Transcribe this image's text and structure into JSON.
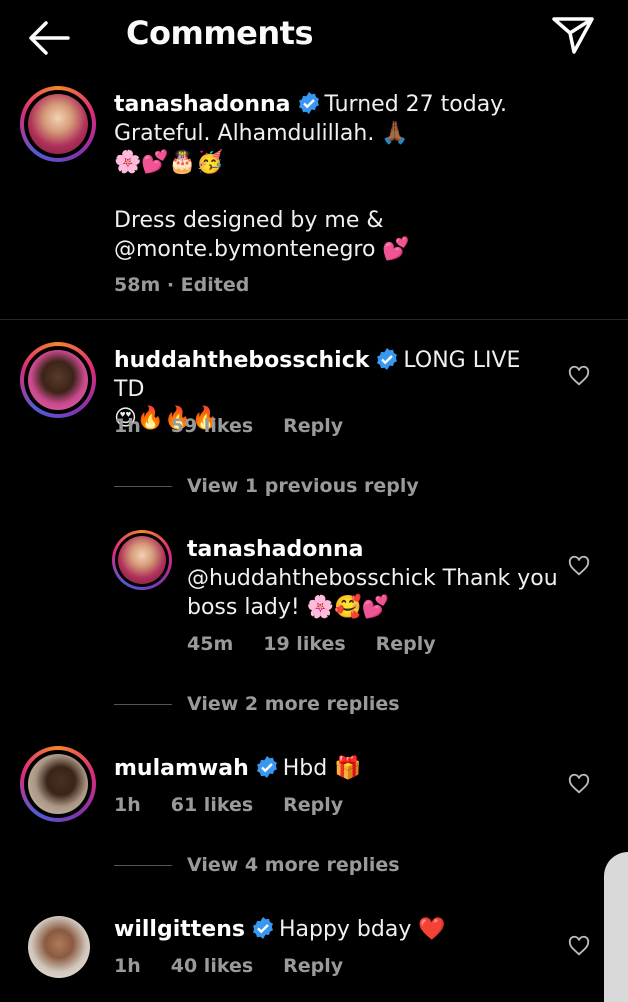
{
  "header": {
    "title": "Comments",
    "back_icon": "arrow-left-icon",
    "share_icon": "paper-plane-icon"
  },
  "caption": {
    "username": "tanashadonna",
    "line1": "Turned 27 today.",
    "line2": "Grateful. Alhamdulillah. 🙏🏾",
    "line3": "🌸💕🎂🥳",
    "line4": "Dress designed by me &",
    "line5": "@monte.bymontenegro 💕",
    "meta": "58m · Edited"
  },
  "comments": [
    {
      "username": "huddahthebosschick",
      "text1": "LONG LIVE TD",
      "text2": "😍🔥🔥🔥",
      "time": "1h",
      "likes": "59 likes",
      "reply": "Reply"
    },
    {
      "username": "mulamwah",
      "text1": "Hbd 🎁",
      "time": "1h",
      "likes": "61 likes",
      "reply": "Reply"
    },
    {
      "username": "willgittens",
      "text1": "Happy bday ❤️",
      "time": "1h",
      "likes": "40 likes",
      "reply": "Reply"
    }
  ],
  "reply": {
    "username": "tanashadonna",
    "text1": "@huddahthebosschick Thank you",
    "text2": "boss lady! 🌸🥰💕",
    "time": "45m",
    "likes": "19 likes",
    "reply": "Reply"
  },
  "threads": {
    "view_previous": "View 1 previous reply",
    "view_more_2": "View 2 more replies",
    "view_more_4": "View 4 more replies"
  },
  "colors": {
    "background": "#000000",
    "muted": "#9a9a9a",
    "verified": "#3897f0"
  }
}
